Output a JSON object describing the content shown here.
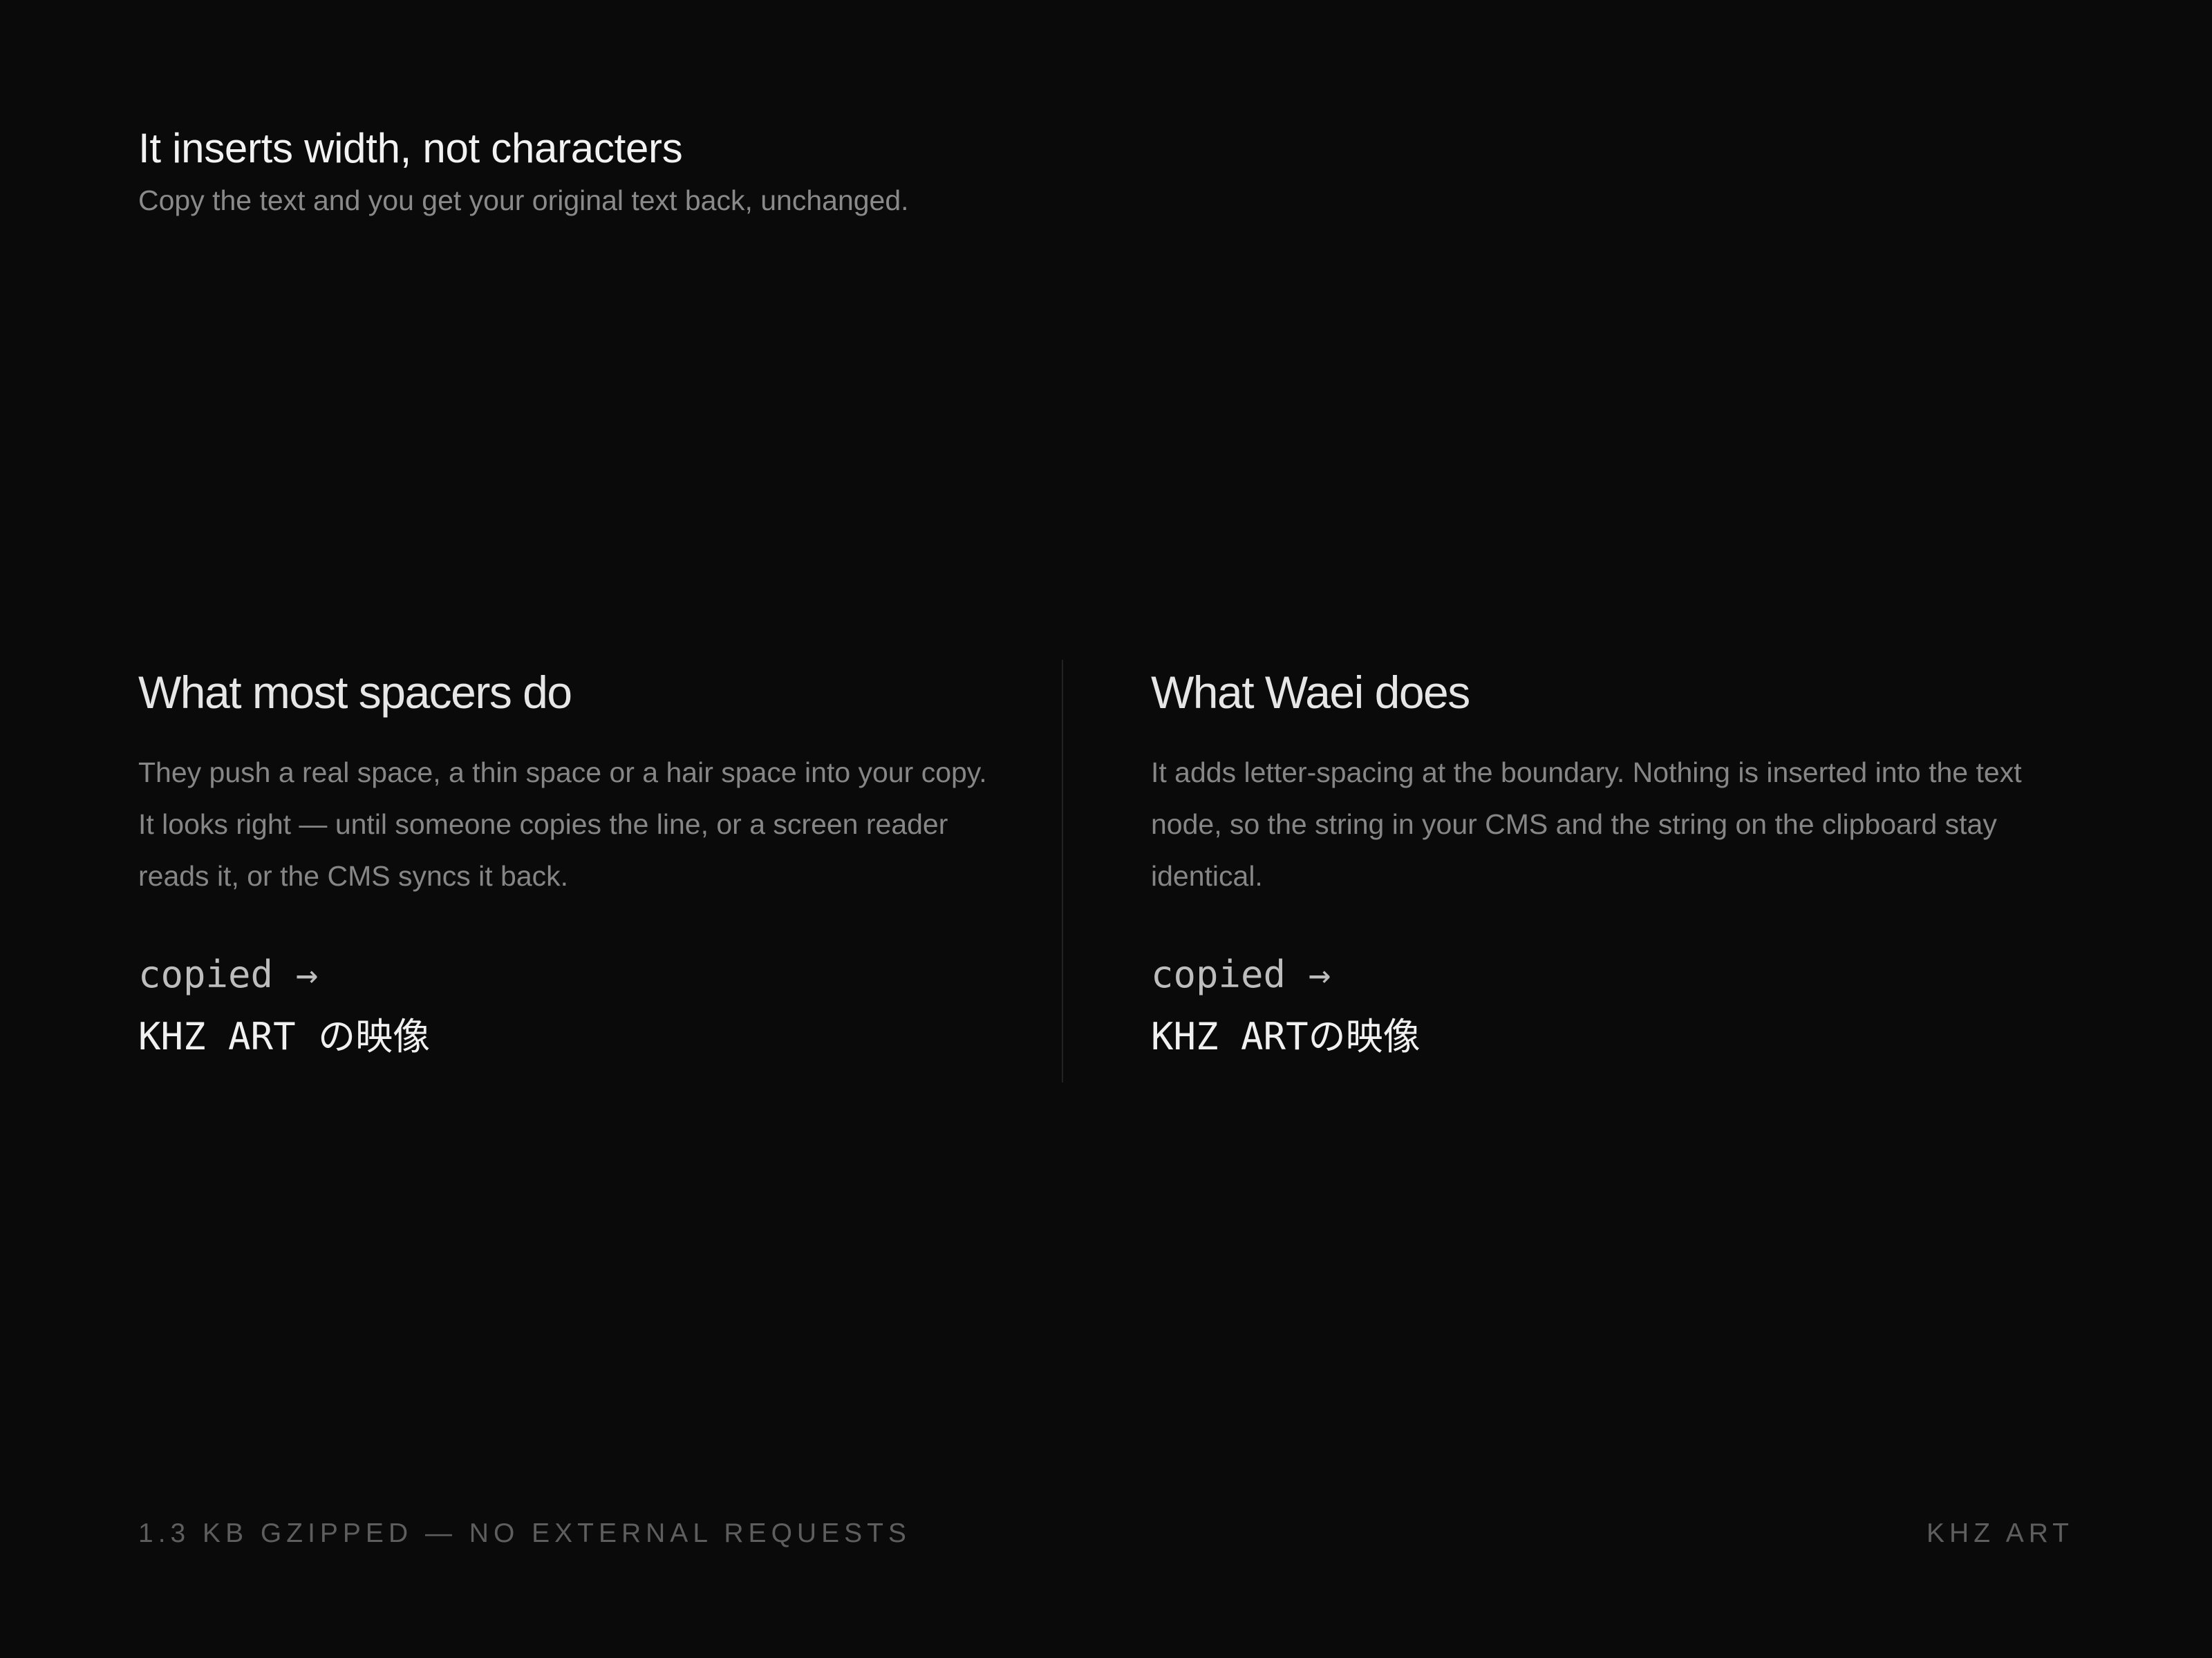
{
  "header": {
    "title": "It inserts width, not characters",
    "subtitle": "Copy the text and you get your original text back, unchanged."
  },
  "comparison": {
    "left": {
      "title": "What most spacers do",
      "body": "They push a real space, a thin space or a hair space into your copy. It looks right — until someone copies the line, or a screen reader reads it, or the CMS syncs it back.",
      "copied_label": "copied →",
      "copied_value": "KHZ ART の映像"
    },
    "right": {
      "title": "What Waei does",
      "body": "It adds letter-spacing at the boundary. Nothing is inserted into the text node, so the string in your CMS and the string on the clipboard stay identical.",
      "copied_label": "copied →",
      "copied_value": "KHZ ARTの映像"
    }
  },
  "footer": {
    "left": "1.3 KB GZIPPED — NO EXTERNAL REQUESTS",
    "right": "KHZ ART"
  },
  "colors": {
    "background": "#0a0a0a",
    "headline": "#f2f2f2",
    "muted_text": "#868686",
    "footer_text": "#5e5e5e",
    "divider": "#222222"
  }
}
